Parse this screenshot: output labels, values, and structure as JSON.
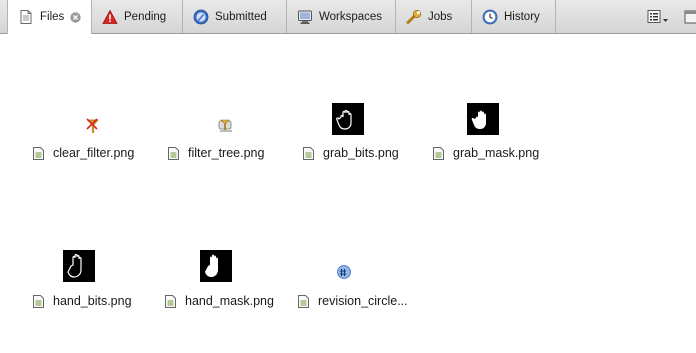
{
  "tabs": [
    {
      "key": "files",
      "label": "Files",
      "icon": "document-icon",
      "active": true,
      "closable": true
    },
    {
      "key": "pending",
      "label": "Pending",
      "icon": "warning-triangle-icon",
      "active": false
    },
    {
      "key": "submitted",
      "label": "Submitted",
      "icon": "submitted-circle-icon",
      "active": false
    },
    {
      "key": "workspaces",
      "label": "Workspaces",
      "icon": "monitor-icon",
      "active": false
    },
    {
      "key": "jobs",
      "label": "Jobs",
      "icon": "wrench-icon",
      "active": false
    },
    {
      "key": "history",
      "label": "History",
      "icon": "clock-icon",
      "active": false
    }
  ],
  "toolbar": {
    "view_menu_icon": "list-view-icon",
    "corner_icon": "window-icon"
  },
  "files": [
    {
      "name": "clear_filter.png",
      "thumbnail": "clear-filter-icon"
    },
    {
      "name": "filter_tree.png",
      "thumbnail": "filter-tree-icon"
    },
    {
      "name": "grab_bits.png",
      "thumbnail": "grab-bits-hand-icon"
    },
    {
      "name": "grab_mask.png",
      "thumbnail": "grab-mask-hand-icon"
    },
    {
      "name": "hand_bits.png",
      "thumbnail": "hand-bits-icon"
    },
    {
      "name": "hand_mask.png",
      "thumbnail": "hand-mask-icon"
    },
    {
      "name": "revision_circle...",
      "thumbnail": "revision-circle-icon"
    }
  ],
  "colors": {
    "tab_bar": "#dcdcdc",
    "pending_red": "#d9261c",
    "submitted_blue": "#3a6fc7"
  }
}
